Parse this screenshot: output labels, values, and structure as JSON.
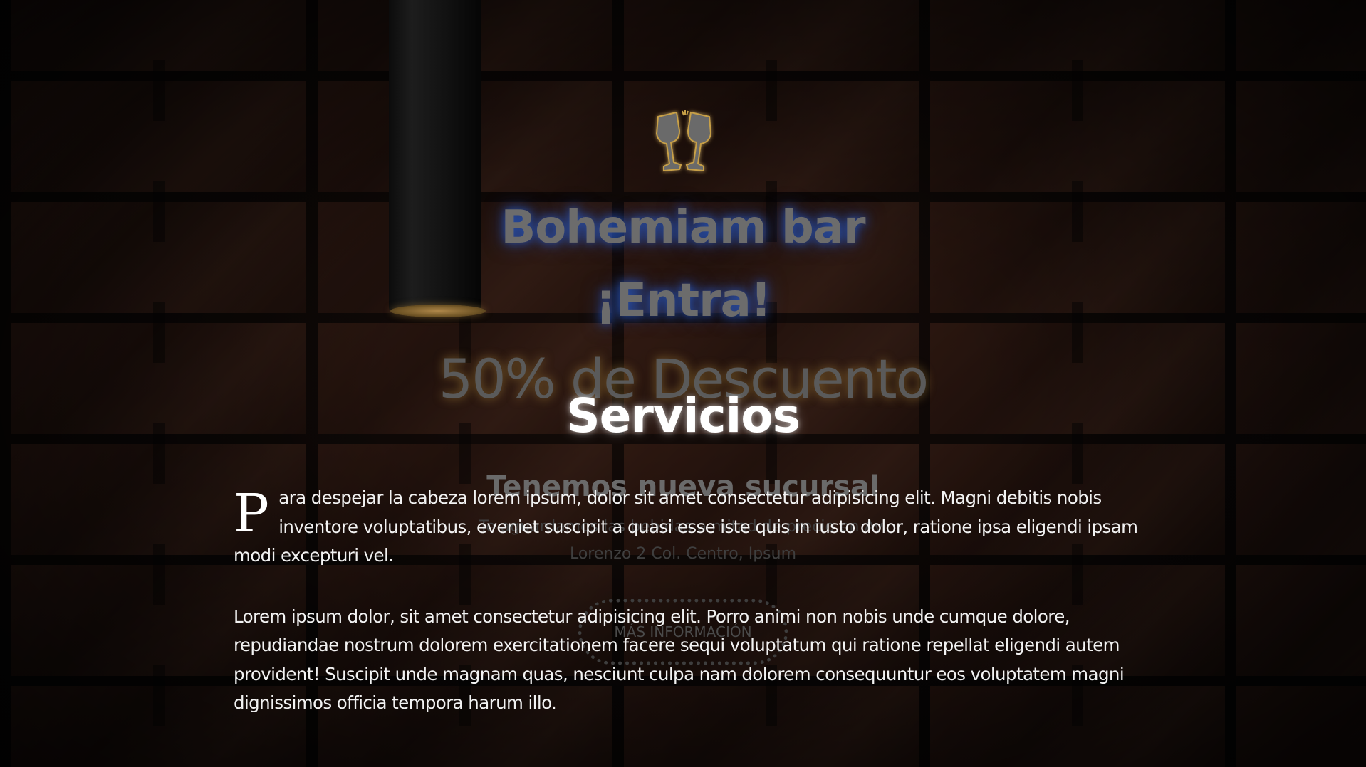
{
  "hero": {
    "title": "Bohemiam bar",
    "subtitle": "¡Entra!",
    "discount": "50% de Descuento"
  },
  "promo": {
    "title": "Tenemos nueva sucursal",
    "text": "Te aguardamos las bebidas a mitad de precio en Av. Lorenzo 2 Col. Centro, Ipsum",
    "button_label": "MÁS INFORMACIÓN"
  },
  "services": {
    "title": "Servicios",
    "drop_cap": "P",
    "paragraph1_rest": "ara despejar la cabeza lorem ipsum, dolor sit amet consectetur adipisicing elit. Magni debitis nobis inventore voluptatibus, eveniet suscipit a quasi esse iste quis in iusto dolor, ratione ipsa eligendi ipsam modi excepturi vel.",
    "paragraph2": "Lorem ipsum dolor, sit amet consectetur adipisicing elit. Porro animi non nobis unde cumque dolore, repudiandae nostrum dolorem exercitationem facere sequi voluptatum qui ratione repellat eligendi autem provident! Suscipit unde magnam quas, nesciunt culpa nam dolorem consequuntur eos voluptatem magni dignissimos officia tempora harum illo."
  },
  "icons": {
    "cheers": "cheers-glasses-icon"
  },
  "colors": {
    "background": "#0a0807",
    "title_glow": "#285ac8",
    "icon_glow": "#c8a046",
    "text": "#f2f2f2"
  }
}
